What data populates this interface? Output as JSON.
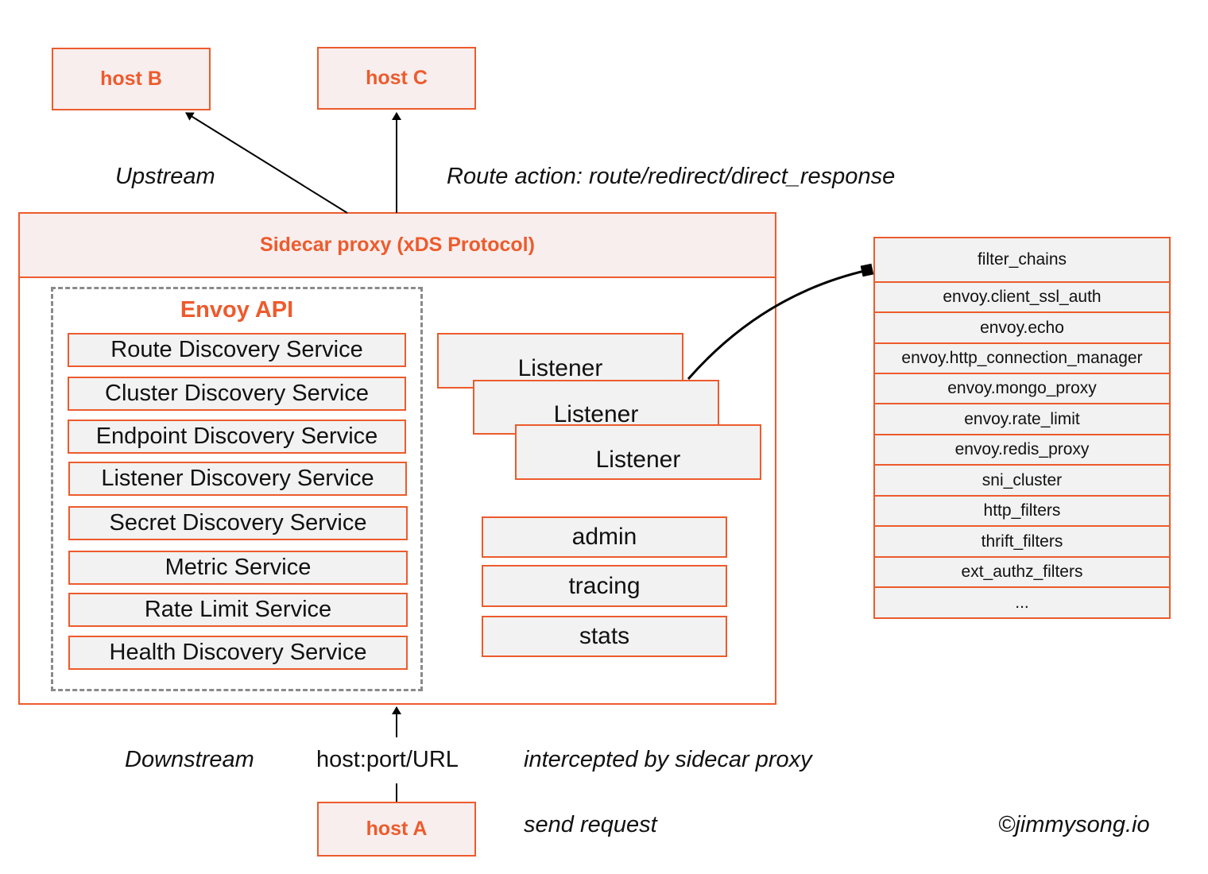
{
  "hosts": {
    "b": "host B",
    "c": "host C",
    "a": "host A"
  },
  "labels": {
    "upstream": "Upstream",
    "route_action": "Route action: route/redirect/direct_response",
    "downstream": "Downstream",
    "host_port_url": "host:port/URL",
    "intercepted": "intercepted by sidecar proxy",
    "send_request": "send request",
    "copyright": "©jimmysong.io"
  },
  "proxy": {
    "title": "Sidecar  proxy (xDS Protocol)",
    "envoy_api": {
      "title": "Envoy API",
      "services": [
        "Route Discovery Service",
        "Cluster Discovery Service",
        "Endpoint Discovery Service",
        "Listener Discovery Service",
        "Secret Discovery Service",
        "Metric Service",
        "Rate Limit Service",
        "Health Discovery Service"
      ]
    },
    "listeners": [
      "Listener",
      "Listener",
      "Listener"
    ],
    "misc": [
      "admin",
      "tracing",
      "stats"
    ]
  },
  "filter_chains": {
    "rows": [
      "filter_chains",
      "envoy.client_ssl_auth",
      "envoy.echo",
      "envoy.http_connection_manager",
      "envoy.mongo_proxy",
      "envoy.rate_limit",
      "envoy.redis_proxy",
      "sni_cluster",
      "http_filters",
      "thrift_filters",
      "ext_authz_filters",
      "..."
    ]
  },
  "colors": {
    "accent": "#ed5b2d",
    "box_fill": "#f1f2f1",
    "header_fill": "#f8eeed",
    "dashed_border": "#8a8a8a"
  }
}
